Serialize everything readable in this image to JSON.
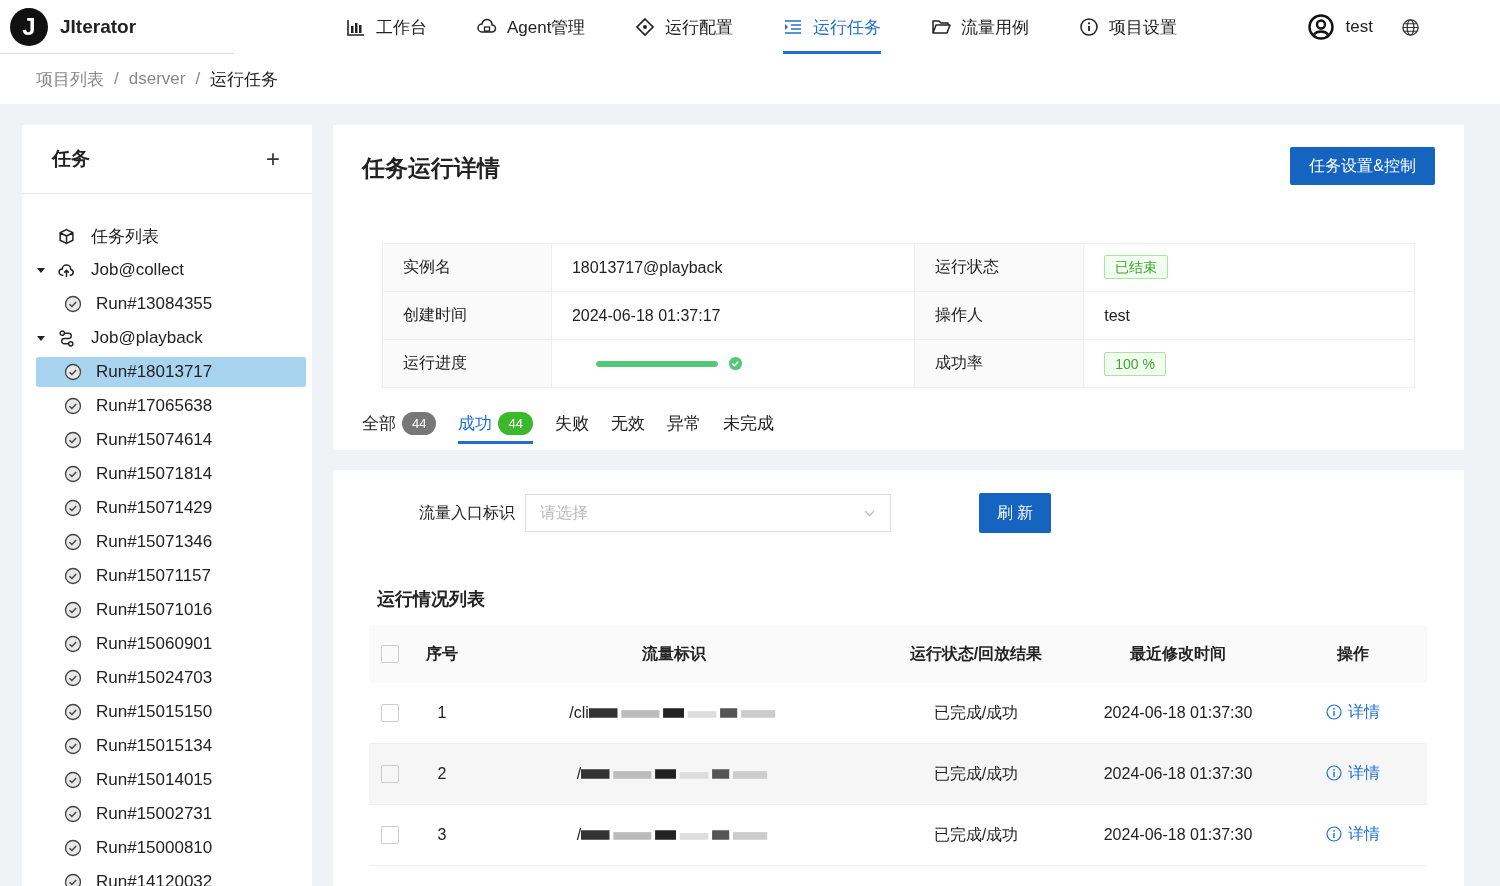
{
  "app": {
    "logo": "J",
    "name": "JIterator"
  },
  "nav": [
    {
      "label": "工作台",
      "selected": false
    },
    {
      "label": "Agent管理",
      "selected": false
    },
    {
      "label": "运行配置",
      "selected": false
    },
    {
      "label": "运行任务",
      "selected": true
    },
    {
      "label": "流量用例",
      "selected": false
    },
    {
      "label": "项目设置",
      "selected": false
    }
  ],
  "user": {
    "name": "test"
  },
  "breadcrumb": {
    "separator": "/",
    "items": [
      "项目列表",
      "dserver",
      "运行任务"
    ]
  },
  "sidebar": {
    "title": "任务",
    "add": "+",
    "tree": [
      {
        "label": "任务列表",
        "selected": false
      },
      {
        "label": "Job@collect",
        "expanded": true,
        "selected": false,
        "children": [
          {
            "label": "Run#13084355",
            "selected": false
          }
        ]
      },
      {
        "label": "Job@playback",
        "expanded": true,
        "selected": false,
        "children": [
          {
            "label": "Run#18013717",
            "selected": true
          },
          {
            "label": "Run#17065638",
            "selected": false
          },
          {
            "label": "Run#15074614",
            "selected": false
          },
          {
            "label": "Run#15071814",
            "selected": false
          },
          {
            "label": "Run#15071429",
            "selected": false
          },
          {
            "label": "Run#15071346",
            "selected": false
          },
          {
            "label": "Run#15071157",
            "selected": false
          },
          {
            "label": "Run#15071016",
            "selected": false
          },
          {
            "label": "Run#15060901",
            "selected": false
          },
          {
            "label": "Run#15024703",
            "selected": false
          },
          {
            "label": "Run#15015150",
            "selected": false
          },
          {
            "label": "Run#15015134",
            "selected": false
          },
          {
            "label": "Run#15014015",
            "selected": false
          },
          {
            "label": "Run#15002731",
            "selected": false
          },
          {
            "label": "Run#15000810",
            "selected": false
          },
          {
            "label": "Run#14120032",
            "selected": false
          }
        ]
      }
    ]
  },
  "detail": {
    "title": "任务运行详情",
    "action": "任务设置&控制",
    "fields": [
      {
        "label": "实例名",
        "value": "18013717@playback",
        "kind": "text"
      },
      {
        "label": "运行状态",
        "value": "已结束",
        "kind": "tag"
      },
      {
        "label": "创建时间",
        "value": "2024-06-18 01:37:17",
        "kind": "text"
      },
      {
        "label": "操作人",
        "value": "test",
        "kind": "text"
      },
      {
        "label": "运行进度",
        "level": 1,
        "kind": "progress"
      },
      {
        "label": "成功率",
        "value": "100 %",
        "kind": "tag"
      }
    ],
    "tabs": [
      {
        "label": "全部",
        "count": "44",
        "selected": false
      },
      {
        "label": "成功",
        "count": "44",
        "selected": true
      },
      {
        "label": "失败",
        "selected": false
      },
      {
        "label": "无效",
        "selected": false
      },
      {
        "label": "异常",
        "selected": false
      },
      {
        "label": "未完成",
        "selected": false
      }
    ]
  },
  "filter": {
    "label": "流量入口标识",
    "placeholder": "请选择",
    "button": "刷 新"
  },
  "table": {
    "title": "运行情况列表",
    "all_checked": false,
    "columns": [
      "序号",
      "流量标识",
      "运行状态/回放结果",
      "最近修改时间",
      "操作"
    ],
    "rows": [
      {
        "checked": false,
        "index": "1",
        "flow": "/cli",
        "status": "已完成/成功",
        "time": "2024-06-18 01:37:30",
        "action": "详情"
      },
      {
        "checked": false,
        "index": "2",
        "flow": "/",
        "status": "已完成/成功",
        "time": "2024-06-18 01:37:30",
        "action": "详情"
      },
      {
        "checked": false,
        "index": "3",
        "flow": "/",
        "status": "已完成/成功",
        "time": "2024-06-18 01:37:30",
        "action": "详情"
      }
    ]
  }
}
